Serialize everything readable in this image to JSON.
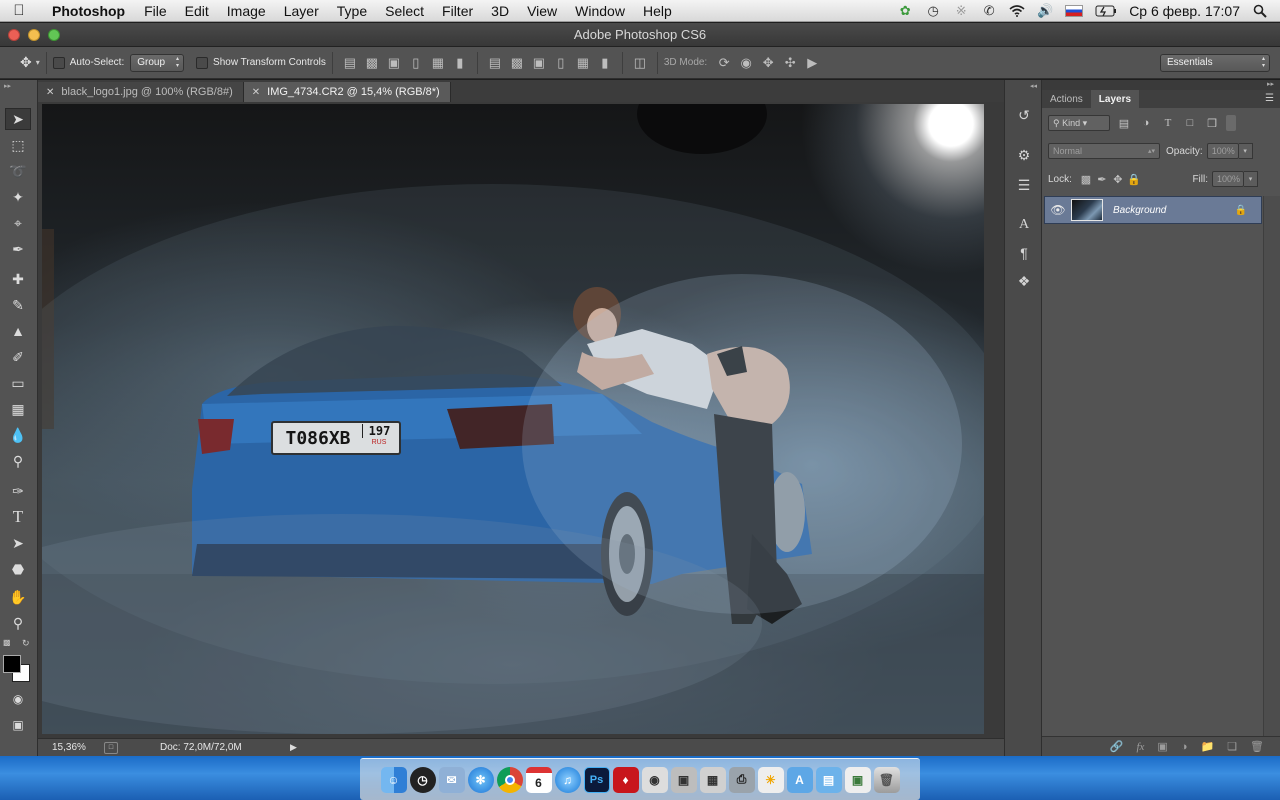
{
  "menubar": {
    "app_name": "Photoshop",
    "menus": [
      "File",
      "Edit",
      "Image",
      "Layer",
      "Type",
      "Select",
      "Filter",
      "3D",
      "View",
      "Window",
      "Help"
    ],
    "date_time": "Ср 6 февр.  17:07",
    "status_icons": [
      "evernote-icon",
      "time-machine-icon",
      "bluetooth-icon",
      "phone-icon",
      "wifi-icon",
      "volume-icon",
      "russian-flag-icon",
      "battery-icon",
      "spotlight-icon"
    ]
  },
  "window": {
    "title": "Adobe Photoshop CS6"
  },
  "options": {
    "auto_select_label": "Auto-Select:",
    "auto_select_value": "Group",
    "transform_label": "Show Transform Controls",
    "mode_3d_label": "3D Mode:",
    "workspace": "Essentials"
  },
  "tabs": [
    {
      "label": "black_logo1.jpg @ 100% (RGB/8#)",
      "active": false
    },
    {
      "label": "IMG_4734.CR2 @ 15,4% (RGB/8*)",
      "active": true
    }
  ],
  "tools": [
    "move-tool-icon",
    "marquee-tool-icon",
    "lasso-tool-icon",
    "quick-select-tool-icon",
    "crop-tool-icon",
    "eyedropper-tool-icon",
    "healing-brush-tool-icon",
    "brush-tool-icon",
    "clone-stamp-tool-icon",
    "history-brush-tool-icon",
    "eraser-tool-icon",
    "gradient-tool-icon",
    "blur-tool-icon",
    "dodge-tool-icon",
    "pen-tool-icon",
    "type-tool-icon",
    "path-select-tool-icon",
    "shape-tool-icon",
    "hand-tool-icon",
    "zoom-tool-icon"
  ],
  "canvas": {
    "plate_text": "T086XB",
    "plate_region": "197",
    "plate_country": "RUS"
  },
  "status": {
    "zoom": "15,36%",
    "doc": "Doc: 72,0M/72,0M"
  },
  "layers_panel": {
    "tabs": [
      "Actions",
      "Layers"
    ],
    "active_tab": "Layers",
    "filter_label": "Kind",
    "blend_mode": "Normal",
    "opacity_label": "Opacity:",
    "opacity_value": "100%",
    "lock_label": "Lock:",
    "fill_label": "Fill:",
    "fill_value": "100%",
    "layers": [
      {
        "name": "Background",
        "visible": true,
        "locked": true
      }
    ]
  },
  "dock_apps": [
    "finder",
    "dashboard",
    "mail",
    "safari",
    "chrome",
    "calendar",
    "itunes",
    "photoshop",
    "flashcard",
    "camera",
    "image-capture",
    "calculator",
    "printer",
    "preview",
    "applications-folder",
    "documents-folder",
    "desktop",
    "trash"
  ],
  "dock_calendar_day": "6",
  "dock_ps_label": "Ps"
}
